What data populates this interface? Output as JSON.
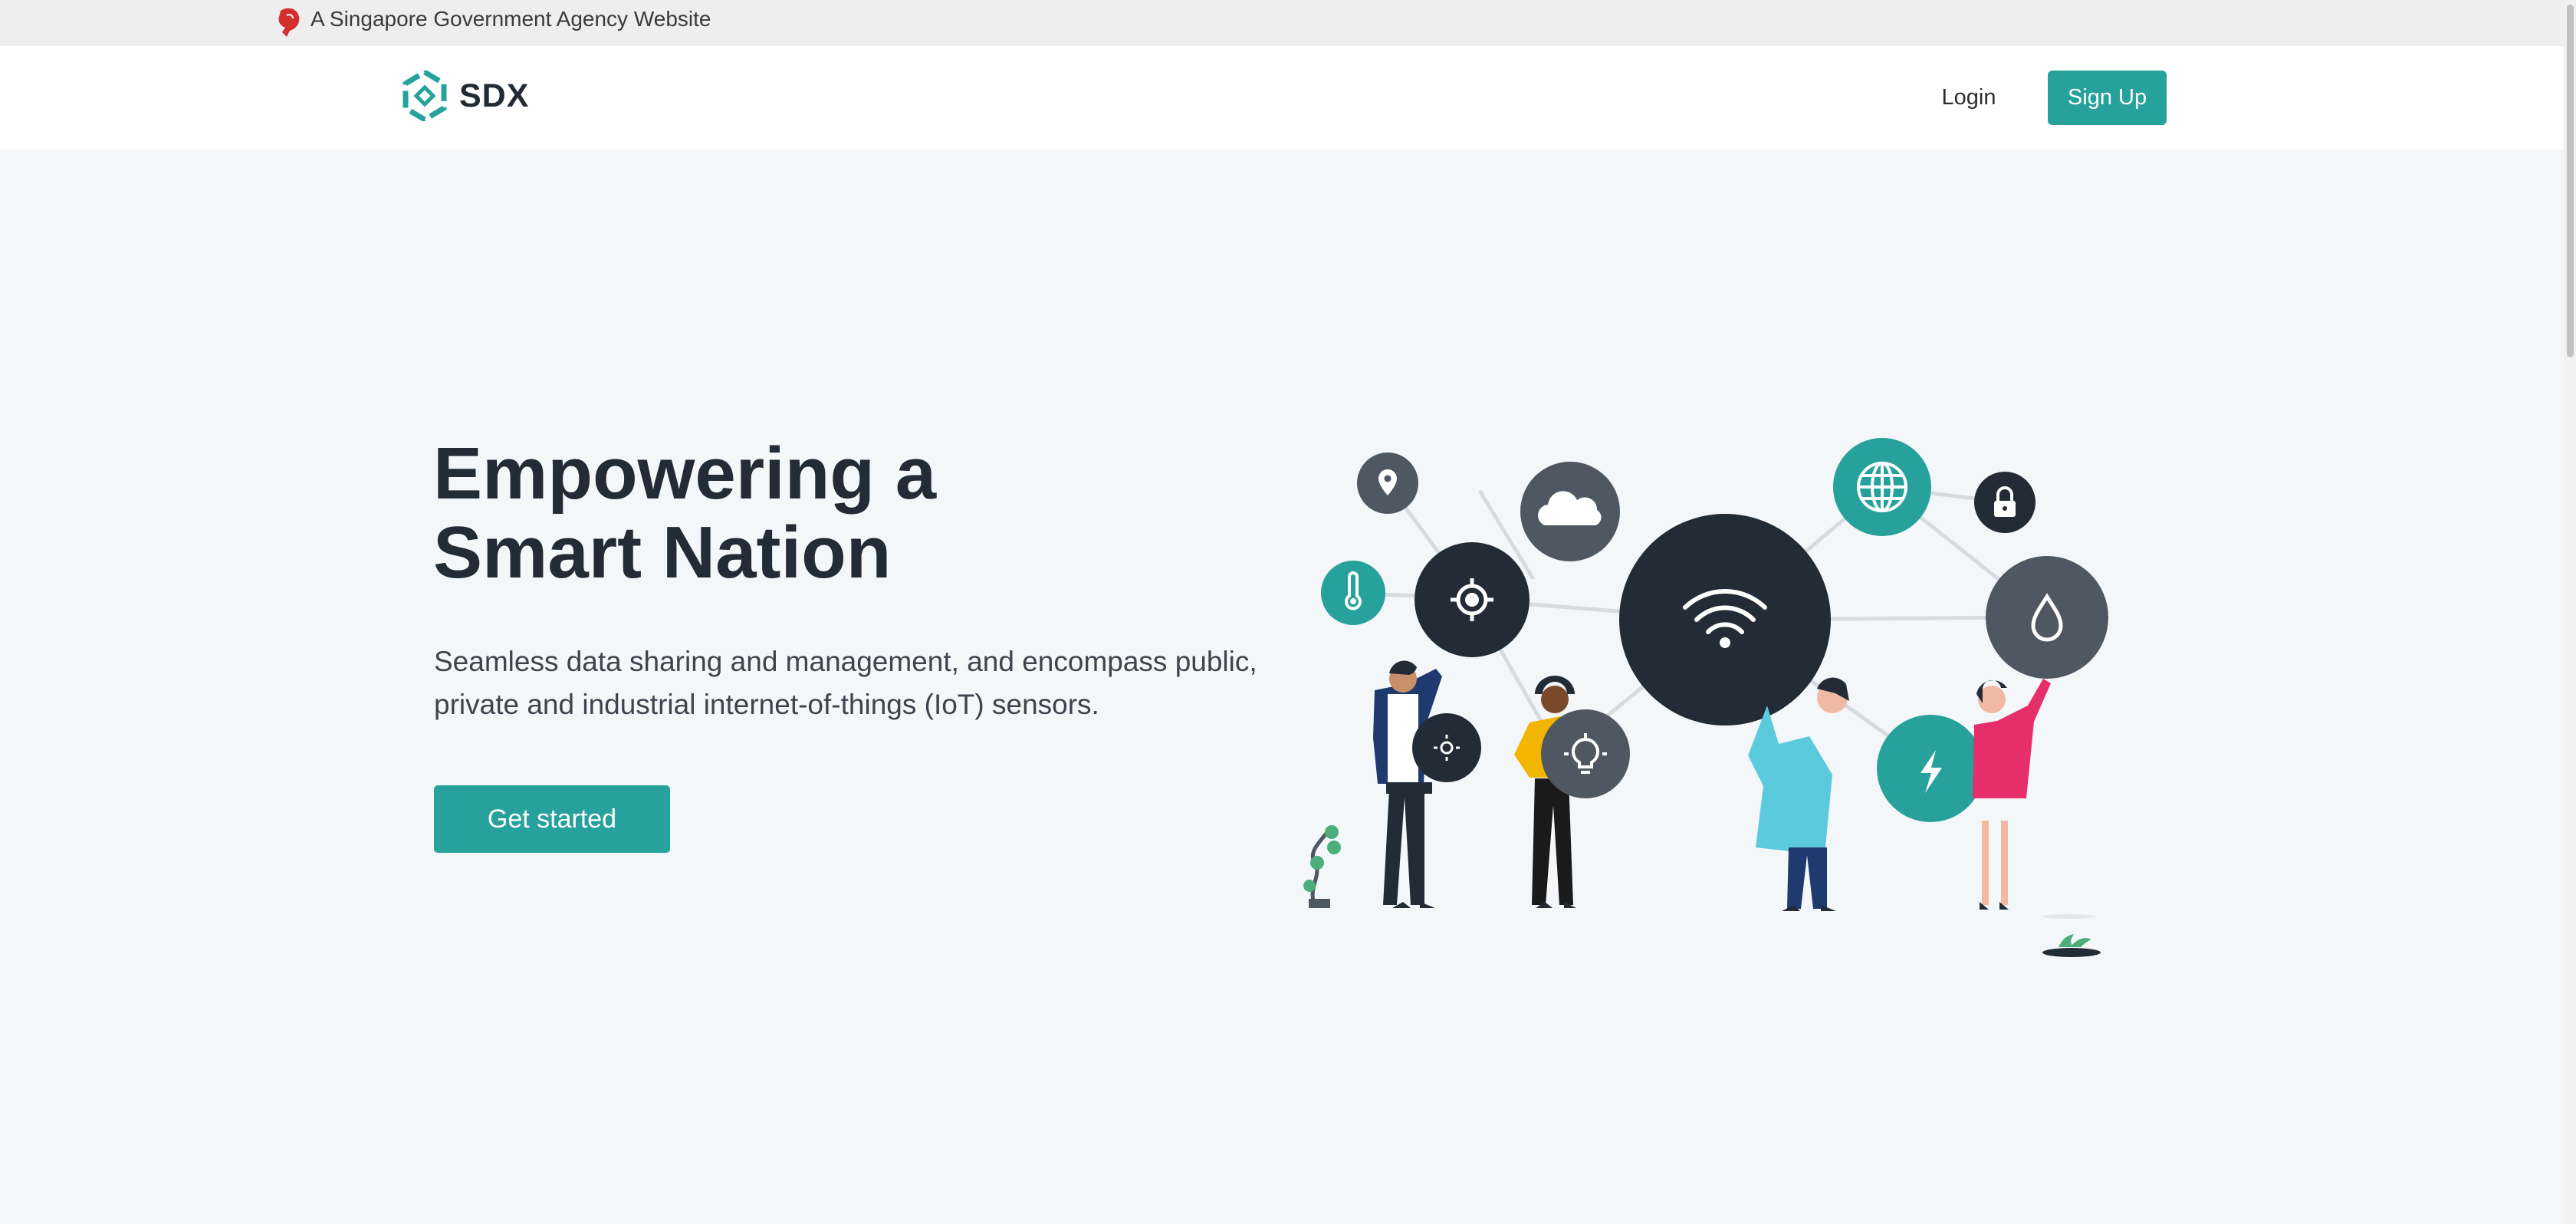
{
  "masthead": {
    "text": "A Singapore Government Agency Website",
    "icon": "singapore-lion-icon"
  },
  "navbar": {
    "brand": "SDX",
    "login_label": "Login",
    "signup_label": "Sign Up"
  },
  "hero": {
    "title_line1": "Empowering a",
    "title_line2": "Smart Nation",
    "subtitle_line1": "Seamless data sharing and management, and encompass public,",
    "subtitle_line2": "private and industrial internet-of-things (IoT) sensors.",
    "cta_label": "Get started"
  },
  "illustration": {
    "icons": [
      "location-pin-icon",
      "cloud-icon",
      "thermometer-icon",
      "target-icon",
      "wifi-icon",
      "globe-icon",
      "lock-icon",
      "water-drop-icon",
      "sun-icon",
      "lightbulb-icon",
      "lightning-icon"
    ]
  },
  "colors": {
    "accent": "#27a19c",
    "dark": "#222b36",
    "node_gray": "#4f5862",
    "background": "#f4f7f9"
  }
}
